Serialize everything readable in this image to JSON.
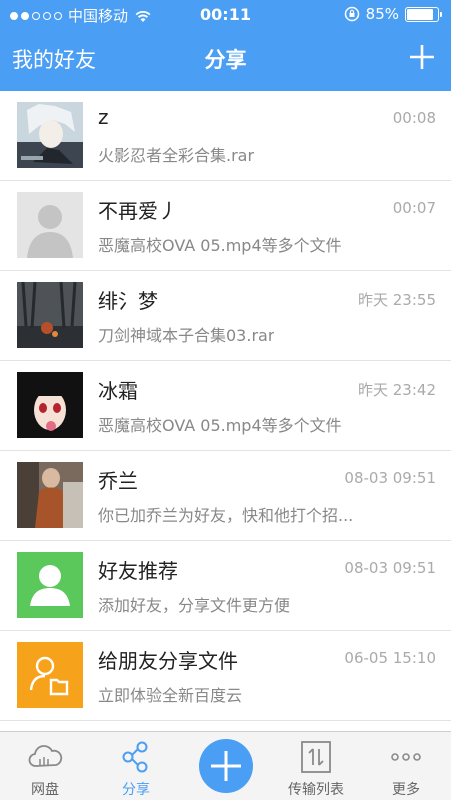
{
  "status_bar": {
    "carrier": "中国移动",
    "time": "00:11",
    "battery": "85%",
    "battery_level": 0.85
  },
  "nav": {
    "left_label": "我的好友",
    "title": "分享"
  },
  "conversations": [
    {
      "name": "z",
      "time": "00:08",
      "subtitle": "火影忍者全彩合集.rar",
      "avatar": "anime-boy-photo"
    },
    {
      "name": "不再爱丿",
      "time": "00:07",
      "subtitle": "恶魔高校OVA 05.mp4等多个文件",
      "avatar": "default-person"
    },
    {
      "name": "绯氵梦",
      "time": "昨天 23:55",
      "subtitle": "刀剑神域本子合集03.rar",
      "avatar": "dark-forest-photo"
    },
    {
      "name": "冰霜",
      "time": "昨天 23:42",
      "subtitle": "恶魔高校OVA 05.mp4等多个文件",
      "avatar": "anime-girl-photo"
    },
    {
      "name": "乔兰",
      "time": "08-03 09:51",
      "subtitle": "你已加乔兰为好友，快和他打个招...",
      "avatar": "person-photo"
    },
    {
      "name": "好友推荐",
      "time": "08-03 09:51",
      "subtitle": "添加好友，分享文件更方便",
      "avatar": "friend-recommend-icon"
    },
    {
      "name": "给朋友分享文件",
      "time": "06-05 15:10",
      "subtitle": "立即体验全新百度云",
      "avatar": "share-file-icon"
    }
  ],
  "tabs": [
    {
      "label": "网盘",
      "icon": "cloud-icon"
    },
    {
      "label": "分享",
      "icon": "share-icon"
    },
    {
      "label": "",
      "icon": "plus-icon"
    },
    {
      "label": "传输列表",
      "icon": "transfer-icon"
    },
    {
      "label": "更多",
      "icon": "more-icon"
    }
  ],
  "colors": {
    "accent": "#4a9ef3",
    "recommend_green": "#5ac85a",
    "share_orange": "#f7a21b"
  }
}
